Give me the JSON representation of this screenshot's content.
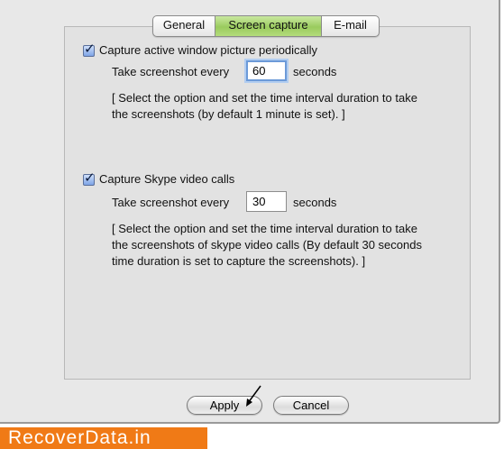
{
  "tabs": [
    {
      "label": "General"
    },
    {
      "label": "Screen capture",
      "selected": true
    },
    {
      "label": "E-mail"
    }
  ],
  "active_window": {
    "checkbox_label": "Capture active window picture periodically",
    "checked": true,
    "interval_label": "Take screenshot every",
    "interval_value": "60",
    "unit_label": "seconds",
    "note": "[ Select the option and set the time interval duration to take\nthe screenshots (by default 1 minute is set). ]"
  },
  "skype": {
    "checkbox_label": "Capture Skype video calls",
    "checked": true,
    "interval_label": "Take screenshot every",
    "interval_value": "30",
    "unit_label": "seconds",
    "note": "[ Select the option and set the time interval duration to take\nthe screenshots of skype video calls (By default 30 seconds\ntime duration is set to capture the screenshots). ]"
  },
  "buttons": {
    "apply": "Apply",
    "cancel": "Cancel"
  },
  "watermark": "RecoverData.in",
  "colors": {
    "selected_tab": "#9acb5e",
    "brand_bg": "#f07a16",
    "checkbox": "#7ea4e6",
    "focus_ring": "#6c9ad8"
  }
}
